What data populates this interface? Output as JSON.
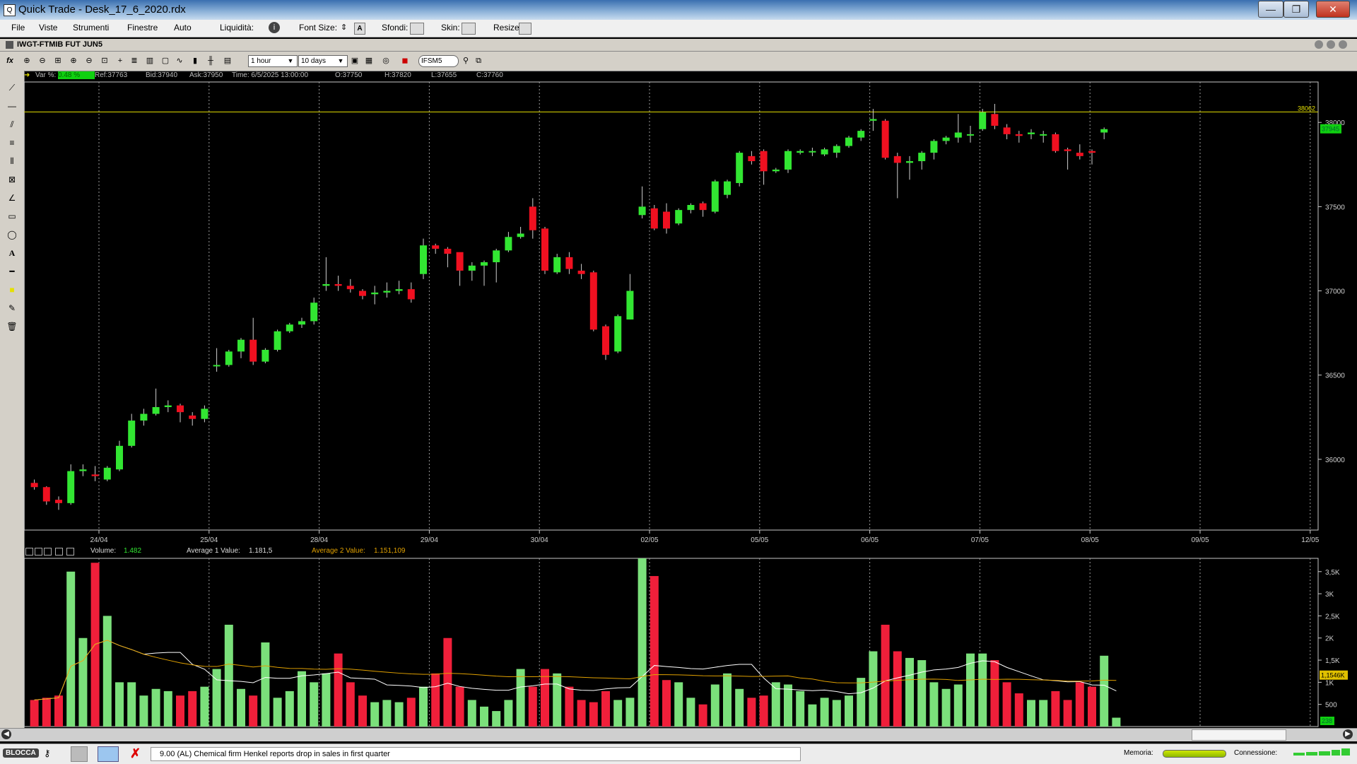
{
  "window": {
    "title": "Quick Trade - Desk_17_6_2020.rdx",
    "min": "—",
    "max": "❐",
    "close": "✕"
  },
  "menu": {
    "items": [
      "File",
      "Viste",
      "Strumenti",
      "Finestre",
      "Auto"
    ],
    "liquidita_label": "Liquidità:",
    "fontsize_label": "Font Size:",
    "sfondi_label": "Sfondi:",
    "skin_label": "Skin:",
    "resize_label": "Resize:"
  },
  "chart_window": {
    "title": "IWGT-FTMIB FUT JUN5"
  },
  "toolbar": {
    "interval": "1 hour",
    "range": "10 days",
    "symbol": "IFSM5"
  },
  "info_line": {
    "var_label": "Var %:",
    "var_value": "0.48 %",
    "ref": "Ref:37763",
    "bid": "Bid:37940",
    "ask": "Ask:37950",
    "time": "Time:  6/5/2025 13:00:00",
    "open": "O:37750",
    "high": "H:37820",
    "low": "L:37655",
    "close": "C:37760"
  },
  "volume_header": {
    "volume_label": "Volume:",
    "volume_value": "1.482",
    "avg1_label": "Average 1 Value:",
    "avg1_value": "1.181,5",
    "avg2_label": "Average 2 Value:",
    "avg2_value": "1.151,109"
  },
  "chart_data": {
    "type": "candlestick",
    "price_axis_ticks": [
      36000,
      36500,
      37000,
      37500,
      38000
    ],
    "price_axis_labels": [
      "36000",
      "36500",
      "37000",
      "37500",
      "38000"
    ],
    "ylim": [
      35580,
      38240
    ],
    "horizontal_line": {
      "value": 38062,
      "label": "38062",
      "color": "#e5e000"
    },
    "last_price_label": "37945",
    "date_labels": [
      "24/04",
      "25/04",
      "28/04",
      "29/04",
      "30/04",
      "02/05",
      "05/05",
      "06/05",
      "07/05",
      "08/05",
      "09/05",
      "12/05"
    ],
    "candles": [
      [
        35860,
        35835,
        35880,
        35820
      ],
      [
        35835,
        35750,
        35840,
        35730
      ],
      [
        35760,
        35740,
        35780,
        35700
      ],
      [
        35740,
        35930,
        35970,
        35730
      ],
      [
        35930,
        35940,
        35970,
        35900
      ],
      [
        35910,
        35900,
        35960,
        35870
      ],
      [
        35880,
        35950,
        35960,
        35870
      ],
      [
        35940,
        36080,
        36110,
        35930
      ],
      [
        36080,
        36230,
        36270,
        36070
      ],
      [
        36230,
        36270,
        36300,
        36200
      ],
      [
        36270,
        36310,
        36420,
        36260
      ],
      [
        36310,
        36320,
        36350,
        36280
      ],
      [
        36320,
        36280,
        36330,
        36220
      ],
      [
        36260,
        36240,
        36280,
        36200
      ],
      [
        36240,
        36300,
        36320,
        36220
      ],
      [
        36560,
        36560,
        36660,
        36520
      ],
      [
        36560,
        36640,
        36650,
        36550
      ],
      [
        36640,
        36710,
        36720,
        36600
      ],
      [
        36710,
        36580,
        36840,
        36560
      ],
      [
        36580,
        36650,
        36660,
        36570
      ],
      [
        36650,
        36760,
        36770,
        36640
      ],
      [
        36760,
        36800,
        36810,
        36750
      ],
      [
        36800,
        36820,
        36840,
        36780
      ],
      [
        36820,
        36930,
        36960,
        36800
      ],
      [
        37030,
        37040,
        37200,
        37000
      ],
      [
        37040,
        37030,
        37090,
        37000
      ],
      [
        37030,
        37010,
        37070,
        36990
      ],
      [
        37000,
        36970,
        37010,
        36950
      ],
      [
        36980,
        36990,
        37030,
        36920
      ],
      [
        36990,
        37000,
        37050,
        36960
      ],
      [
        37000,
        37010,
        37060,
        36980
      ],
      [
        37010,
        36950,
        37050,
        36930
      ],
      [
        37100,
        37270,
        37310,
        37070
      ],
      [
        37270,
        37250,
        37280,
        37220
      ],
      [
        37250,
        37220,
        37260,
        37140
      ],
      [
        37230,
        37120,
        37150,
        37030
      ],
      [
        37120,
        37150,
        37170,
        37060
      ],
      [
        37150,
        37170,
        37180,
        37030
      ],
      [
        37170,
        37240,
        37250,
        37050
      ],
      [
        37240,
        37320,
        37350,
        37230
      ],
      [
        37320,
        37340,
        37380,
        37310
      ],
      [
        37500,
        37360,
        37550,
        37310
      ],
      [
        37370,
        37120,
        37380,
        37100
      ],
      [
        37110,
        37200,
        37220,
        37100
      ],
      [
        37200,
        37130,
        37230,
        37100
      ],
      [
        37120,
        37100,
        37160,
        37070
      ],
      [
        37110,
        36770,
        37120,
        36760
      ],
      [
        36790,
        36620,
        36800,
        36590
      ],
      [
        36640,
        36850,
        36860,
        36630
      ],
      [
        36830,
        37000,
        37100,
        36830
      ],
      [
        37450,
        37500,
        37620,
        37430
      ],
      [
        37490,
        37370,
        37510,
        37360
      ],
      [
        37470,
        37370,
        37520,
        37340
      ],
      [
        37400,
        37480,
        37490,
        37390
      ],
      [
        37480,
        37510,
        37520,
        37460
      ],
      [
        37520,
        37480,
        37530,
        37440
      ],
      [
        37470,
        37650,
        37660,
        37460
      ],
      [
        37570,
        37650,
        37660,
        37550
      ],
      [
        37640,
        37820,
        37830,
        37620
      ],
      [
        37800,
        37770,
        37830,
        37750
      ],
      [
        37830,
        37710,
        37840,
        37630
      ],
      [
        37710,
        37720,
        37730,
        37700
      ],
      [
        37720,
        37830,
        37840,
        37700
      ],
      [
        37820,
        37830,
        37840,
        37810
      ],
      [
        37830,
        37830,
        37850,
        37800
      ],
      [
        37810,
        37840,
        37850,
        37800
      ],
      [
        37820,
        37860,
        37870,
        37790
      ],
      [
        37860,
        37910,
        37920,
        37850
      ],
      [
        37910,
        37950,
        37960,
        37890
      ],
      [
        38010,
        38020,
        38080,
        37950
      ],
      [
        38010,
        37790,
        38020,
        37780
      ],
      [
        37800,
        37760,
        37820,
        37550
      ],
      [
        37760,
        37770,
        37800,
        37660
      ],
      [
        37770,
        37820,
        37830,
        37720
      ],
      [
        37820,
        37890,
        37900,
        37780
      ],
      [
        37890,
        37910,
        37920,
        37870
      ],
      [
        37910,
        37940,
        38050,
        37880
      ],
      [
        37930,
        37930,
        37980,
        37880
      ],
      [
        37960,
        38060,
        38080,
        37950
      ],
      [
        38050,
        37980,
        38110,
        37960
      ],
      [
        37970,
        37930,
        37990,
        37900
      ],
      [
        37930,
        37920,
        37950,
        37880
      ],
      [
        37930,
        37940,
        37960,
        37900
      ],
      [
        37930,
        37930,
        37950,
        37880
      ],
      [
        37930,
        37830,
        37940,
        37820
      ],
      [
        37840,
        37830,
        37850,
        37720
      ],
      [
        37820,
        37800,
        37870,
        37780
      ],
      [
        37830,
        37820,
        37840,
        37750
      ],
      [
        37940,
        37960,
        37970,
        37900
      ]
    ],
    "volume_axis_labels": [
      "3,5K",
      "3K",
      "2,5K",
      "2K",
      "1,5K",
      "1K",
      "500"
    ],
    "volume_axis_values": [
      3500,
      3000,
      2500,
      2000,
      1500,
      1000,
      500
    ],
    "volume_ylim": [
      0,
      3800
    ],
    "volume_last_label": "1,1546K",
    "volume_small_label": "238",
    "volumes": [
      600,
      650,
      700,
      3500,
      2000,
      3700,
      2500,
      1000,
      1000,
      700,
      850,
      800,
      700,
      800,
      900,
      1300,
      2300,
      850,
      700,
      1900,
      650,
      800,
      1250,
      1000,
      1200,
      1650,
      1000,
      700,
      550,
      600,
      550,
      650,
      900,
      1200,
      2000,
      900,
      600,
      450,
      350,
      600,
      1300,
      900,
      1300,
      1200,
      900,
      600,
      550,
      800,
      600,
      650,
      3800,
      3400,
      1050,
      1000,
      650,
      500,
      950,
      1200,
      850,
      650,
      700,
      1000,
      950,
      800,
      500,
      650,
      600,
      700,
      1100,
      1700,
      2300,
      1700,
      1550,
      1500,
      1000,
      850,
      950,
      1650,
      1650,
      1500,
      1000,
      750,
      600,
      600,
      800,
      600,
      1000,
      900,
      1600,
      200
    ],
    "volume_colors": "up=green, down=red"
  },
  "news": {
    "text": "9.00 (AL) Chemical firm Henkel reports drop in sales in first quarter"
  },
  "status": {
    "blocca": "BLOCCA",
    "memoria_label": "Memoria:",
    "connessione_label": "Connessione:"
  },
  "colors": {
    "up": "#32e632",
    "down": "#f01020",
    "accent_line": "#e5e000",
    "avg1": "#ffffff",
    "avg2": "#e0a000"
  }
}
